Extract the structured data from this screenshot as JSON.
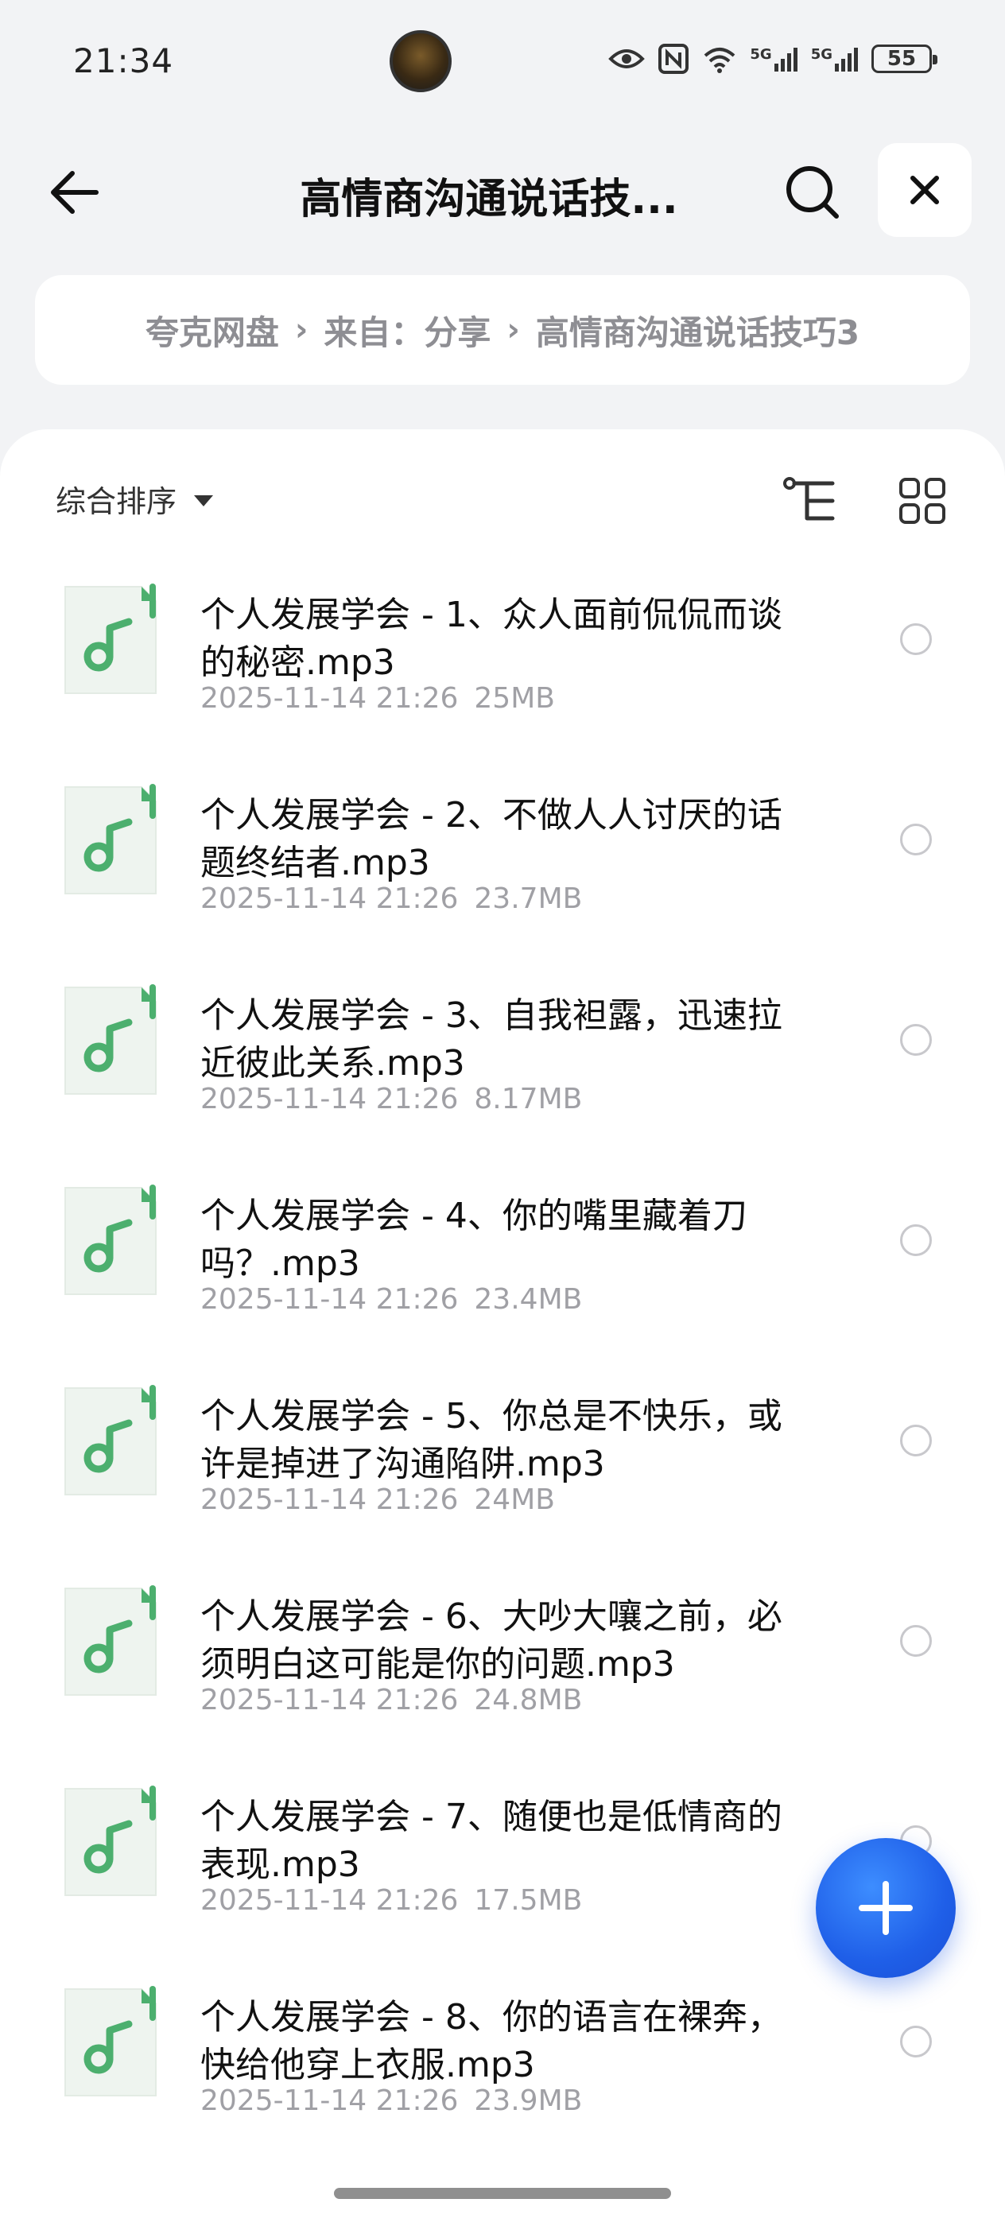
{
  "status_bar": {
    "time": "21:34",
    "battery": "55",
    "network_1": "5G",
    "network_2": "5G"
  },
  "header": {
    "title": "高情商沟通说话技..."
  },
  "breadcrumb": {
    "items": [
      "夸克网盘",
      "来自：分享",
      "高情商沟通说话技巧3"
    ],
    "separator": "›"
  },
  "toolbar": {
    "sort_label": "综合排序"
  },
  "files": [
    {
      "name": "个人发展学会 - 1、众人面前侃侃而谈的秘密.mp3",
      "date": "2025-11-14 21:26",
      "size": "25MB"
    },
    {
      "name": "个人发展学会 - 2、不做人人讨厌的话题终结者.mp3",
      "date": "2025-11-14 21:26",
      "size": "23.7MB"
    },
    {
      "name": "个人发展学会 - 3、自我袒露，迅速拉近彼此关系.mp3",
      "date": "2025-11-14 21:26",
      "size": "8.17MB"
    },
    {
      "name": "个人发展学会 - 4、你的嘴里藏着刀吗？.mp3",
      "date": "2025-11-14 21:26",
      "size": "23.4MB"
    },
    {
      "name": "个人发展学会 - 5、你总是不快乐，或许是掉进了沟通陷阱.mp3",
      "date": "2025-11-14 21:26",
      "size": "24MB"
    },
    {
      "name": "个人发展学会 - 6、大吵大嚷之前，必须明白这可能是你的问题.mp3",
      "date": "2025-11-14 21:26",
      "size": "24.8MB"
    },
    {
      "name": "个人发展学会 - 7、随便也是低情商的表现.mp3",
      "date": "2025-11-14 21:26",
      "size": "17.5MB"
    },
    {
      "name": "个人发展学会 - 8、你的语言在裸奔，快给他穿上衣服.mp3",
      "date": "2025-11-14 21:26",
      "size": "23.9MB"
    }
  ],
  "colors": {
    "accent": "#1f5fe8",
    "file_icon_green": "#4caf6e",
    "background": "#f2f3f5"
  },
  "icons": {
    "back": "arrow-left-icon",
    "search": "search-icon",
    "close": "close-icon",
    "tree": "tree-view-icon",
    "grid": "grid-view-icon",
    "file": "music-file-icon",
    "fab": "plus-icon"
  }
}
